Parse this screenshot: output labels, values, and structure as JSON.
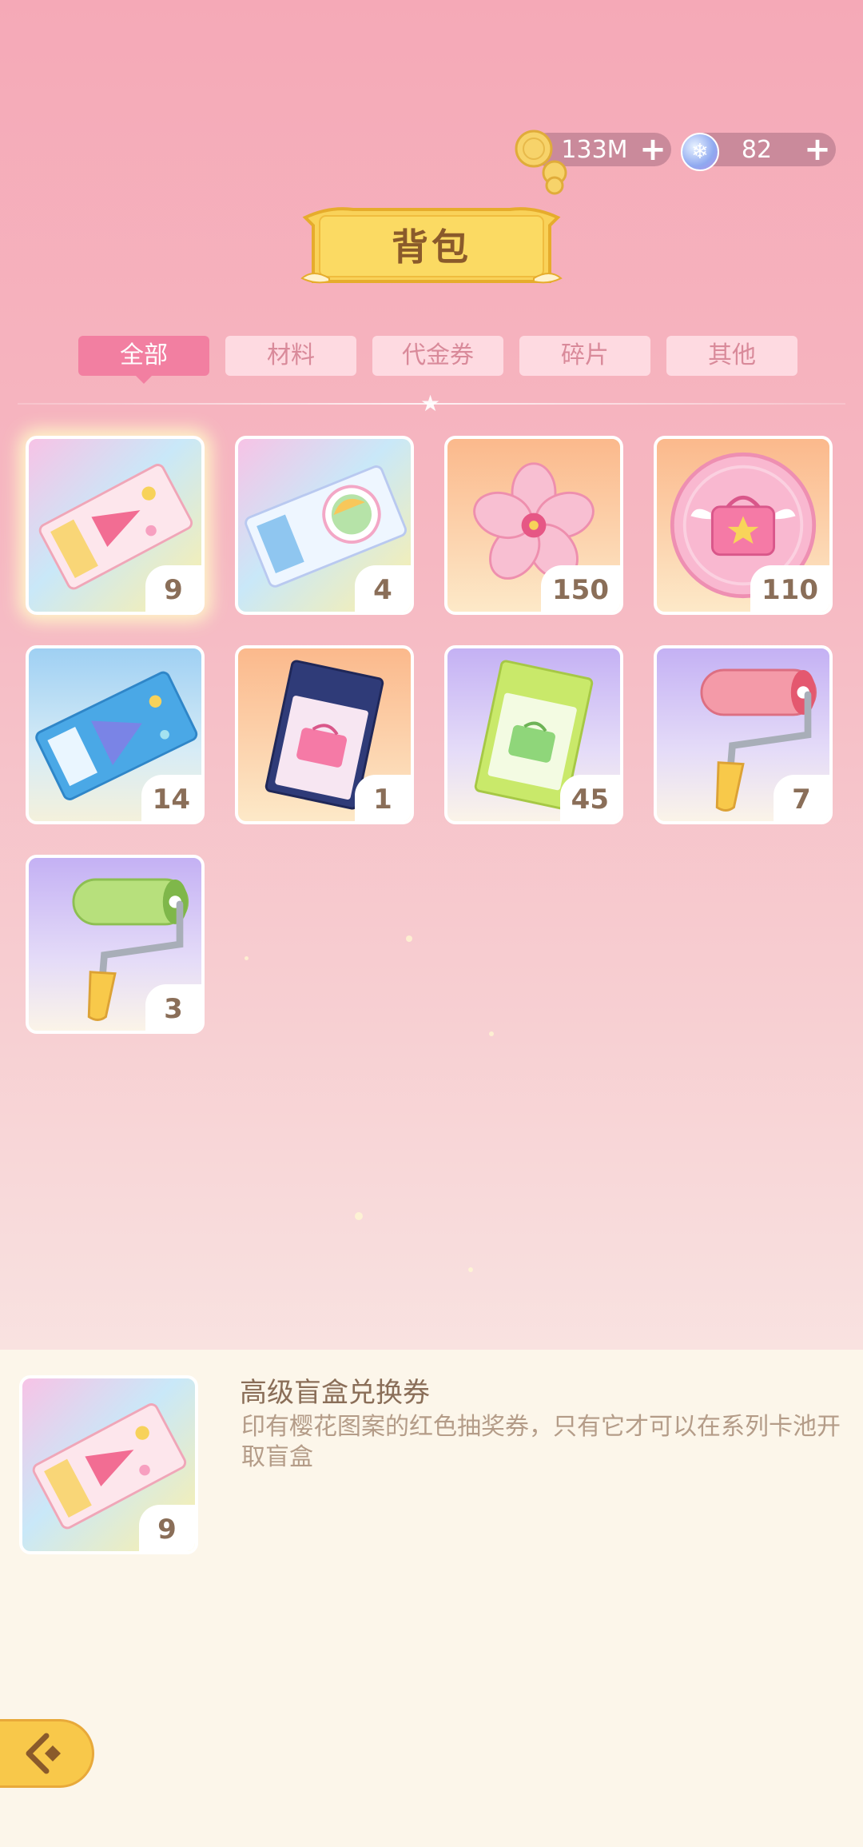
{
  "currency": {
    "coins": {
      "icon": "coin-stack-icon",
      "value": "133M"
    },
    "gems": {
      "icon": "snowflake-gem-icon",
      "value": "82"
    }
  },
  "title": "背包",
  "tabs": [
    {
      "label": "全部",
      "active": true
    },
    {
      "label": "材料",
      "active": false
    },
    {
      "label": "代金券",
      "active": false
    },
    {
      "label": "碎片",
      "active": false
    },
    {
      "label": "其他",
      "active": false
    }
  ],
  "items": [
    {
      "icon": "premium-ticket-icon",
      "count": "9"
    },
    {
      "icon": "sakura-card-ticket-icon",
      "count": "4"
    },
    {
      "icon": "cherry-blossom-icon",
      "count": "150"
    },
    {
      "icon": "pink-box-coin-icon",
      "count": "110"
    },
    {
      "icon": "blue-ticket-icon",
      "count": "14"
    },
    {
      "icon": "navy-box-ticket-icon",
      "count": "1"
    },
    {
      "icon": "green-box-ticket-icon",
      "count": "45"
    },
    {
      "icon": "pink-paint-roller-icon",
      "count": "7"
    },
    {
      "icon": "green-paint-roller-icon",
      "count": "3"
    }
  ],
  "selected": {
    "icon": "premium-ticket-icon",
    "count": "9",
    "name": "高级盲盒兑换券",
    "description": "印有樱花图案的红色抽奖券，只有它才可以在系列卡池开取盲盒"
  },
  "back_icon": "back-arrow-icon"
}
